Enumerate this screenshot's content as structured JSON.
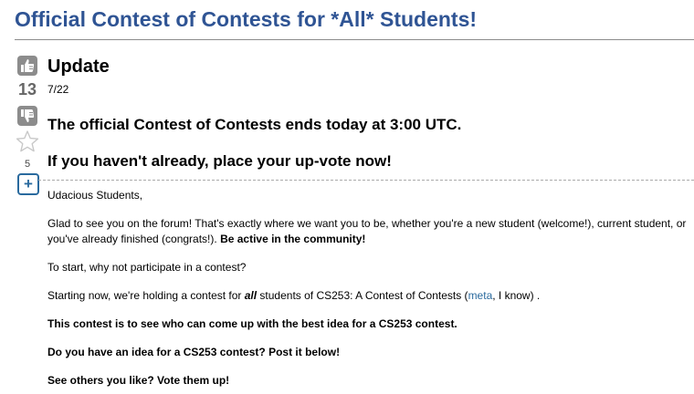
{
  "question": {
    "title": "Official Contest of Contests for *All* Students!"
  },
  "votes": {
    "score": "13",
    "favorite_count": "5",
    "up_icon": "thumbs-up-icon",
    "down_icon": "thumbs-down-icon",
    "favorite_icon": "star-icon",
    "follow_label": "+"
  },
  "post": {
    "update_heading": "Update",
    "update_date": "7/22",
    "announcement_1": "The official Contest of Contests ends today at 3:00 UTC.",
    "announcement_2": "If you haven't already, place your up-vote now!",
    "greeting": "Udacious Students,",
    "intro_1": "Glad to see you on the forum! That's exactly where we want you to be, whether you're a new student (welcome!), current student, or you've already finished (congrats!). ",
    "intro_bold": "Be active in the community!",
    "start": "To start, why not participate in a contest?",
    "contest_pre": "Starting now, we're holding a contest for ",
    "contest_all": "all",
    "contest_mid": " students of CS253: A Contest of Contests (",
    "contest_link": "meta",
    "contest_post": ", I know) .",
    "goal": "This contest is to see who can come up with the best idea for a CS253 contest.",
    "cta": "Do you have an idea for a CS253 contest? Post it below!",
    "vote_cta": "See others you like? Vote them up!"
  },
  "colors": {
    "title": "#2f5494",
    "link": "#2a6a9e",
    "vote_button": "#8c8c8c"
  }
}
